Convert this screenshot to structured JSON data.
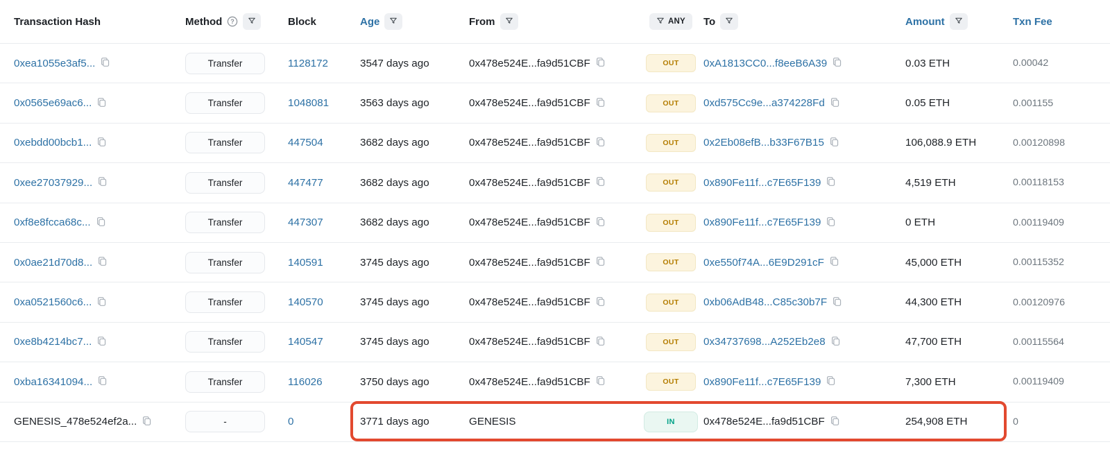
{
  "header": {
    "transaction_hash": "Transaction Hash",
    "method": "Method",
    "block": "Block",
    "age": "Age",
    "from": "From",
    "any_filter": "ANY",
    "to": "To",
    "amount": "Amount",
    "txn_fee": "Txn Fee"
  },
  "icons": {
    "method_help": "question-circle-icon",
    "filter": "funnel-icon",
    "copy": "copy-icon"
  },
  "colors": {
    "link_blue": "#2d71a5",
    "text_dark": "#1d2126",
    "text_gray": "#6c757d",
    "row_border": "#e9ecef",
    "out_text": "#b47d00",
    "out_bg": "#fcf4de",
    "in_text": "#00a186",
    "in_bg": "#eaf7f2",
    "highlight_red": "#e2492f"
  },
  "rows": [
    {
      "hash": "0xea1055e3af5...",
      "hash_link": true,
      "method": "Transfer",
      "block": "1128172",
      "age": "3547 days ago",
      "from": "0x478e524E...fa9d51CBF",
      "from_copy": true,
      "direction": "OUT",
      "to": "0xA1813CC0...f8eeB6A39",
      "to_link": true,
      "amount": "0.03 ETH",
      "txn_fee": "0.00042",
      "highlighted": false
    },
    {
      "hash": "0x0565e69ac6...",
      "hash_link": true,
      "method": "Transfer",
      "block": "1048081",
      "age": "3563 days ago",
      "from": "0x478e524E...fa9d51CBF",
      "from_copy": true,
      "direction": "OUT",
      "to": "0xd575Cc9e...a374228Fd",
      "to_link": true,
      "amount": "0.05 ETH",
      "txn_fee": "0.001155",
      "highlighted": false
    },
    {
      "hash": "0xebdd00bcb1...",
      "hash_link": true,
      "method": "Transfer",
      "block": "447504",
      "age": "3682 days ago",
      "from": "0x478e524E...fa9d51CBF",
      "from_copy": true,
      "direction": "OUT",
      "to": "0x2Eb08efB...b33F67B15",
      "to_link": true,
      "amount": "106,088.9 ETH",
      "txn_fee": "0.00120898",
      "highlighted": false
    },
    {
      "hash": "0xee27037929...",
      "hash_link": true,
      "method": "Transfer",
      "block": "447477",
      "age": "3682 days ago",
      "from": "0x478e524E...fa9d51CBF",
      "from_copy": true,
      "direction": "OUT",
      "to": "0x890Fe11f...c7E65F139",
      "to_link": true,
      "amount": "4,519 ETH",
      "txn_fee": "0.00118153",
      "highlighted": false
    },
    {
      "hash": "0xf8e8fcca68c...",
      "hash_link": true,
      "method": "Transfer",
      "block": "447307",
      "age": "3682 days ago",
      "from": "0x478e524E...fa9d51CBF",
      "from_copy": true,
      "direction": "OUT",
      "to": "0x890Fe11f...c7E65F139",
      "to_link": true,
      "amount": "0 ETH",
      "txn_fee": "0.00119409",
      "highlighted": false
    },
    {
      "hash": "0x0ae21d70d8...",
      "hash_link": true,
      "method": "Transfer",
      "block": "140591",
      "age": "3745 days ago",
      "from": "0x478e524E...fa9d51CBF",
      "from_copy": true,
      "direction": "OUT",
      "to": "0xe550f74A...6E9D291cF",
      "to_link": true,
      "amount": "45,000 ETH",
      "txn_fee": "0.00115352",
      "highlighted": false
    },
    {
      "hash": "0xa0521560c6...",
      "hash_link": true,
      "method": "Transfer",
      "block": "140570",
      "age": "3745 days ago",
      "from": "0x478e524E...fa9d51CBF",
      "from_copy": true,
      "direction": "OUT",
      "to": "0xb06AdB48...C85c30b7F",
      "to_link": true,
      "amount": "44,300 ETH",
      "txn_fee": "0.00120976",
      "highlighted": false
    },
    {
      "hash": "0xe8b4214bc7...",
      "hash_link": true,
      "method": "Transfer",
      "block": "140547",
      "age": "3745 days ago",
      "from": "0x478e524E...fa9d51CBF",
      "from_copy": true,
      "direction": "OUT",
      "to": "0x34737698...A252Eb2e8",
      "to_link": true,
      "amount": "47,700 ETH",
      "txn_fee": "0.00115564",
      "highlighted": false
    },
    {
      "hash": "0xba16341094...",
      "hash_link": true,
      "method": "Transfer",
      "block": "116026",
      "age": "3750 days ago",
      "from": "0x478e524E...fa9d51CBF",
      "from_copy": true,
      "direction": "OUT",
      "to": "0x890Fe11f...c7E65F139",
      "to_link": true,
      "amount": "7,300 ETH",
      "txn_fee": "0.00119409",
      "highlighted": false
    },
    {
      "hash": "GENESIS_478e524ef2a...",
      "hash_link": false,
      "method": "-",
      "block": "0",
      "age": "3771 days ago",
      "from": "GENESIS",
      "from_copy": false,
      "direction": "IN",
      "to": "0x478e524E...fa9d51CBF",
      "to_link": false,
      "amount": "254,908 ETH",
      "txn_fee": "0",
      "highlighted": true
    }
  ]
}
